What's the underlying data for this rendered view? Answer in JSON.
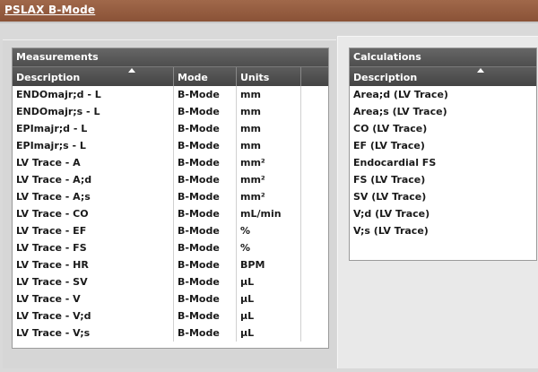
{
  "header": {
    "title": "PSLAX B-Mode"
  },
  "measurements": {
    "title": "Measurements",
    "columns": [
      "Description",
      "Mode",
      "Units"
    ],
    "rows": [
      [
        "ENDOmajr;d - L",
        "B-Mode",
        "mm"
      ],
      [
        "ENDOmajr;s - L",
        "B-Mode",
        "mm"
      ],
      [
        "EPImajr;d - L",
        "B-Mode",
        "mm"
      ],
      [
        "EPImajr;s - L",
        "B-Mode",
        "mm"
      ],
      [
        "LV Trace - A",
        "B-Mode",
        "mm²"
      ],
      [
        "LV Trace - A;d",
        "B-Mode",
        "mm²"
      ],
      [
        "LV Trace - A;s",
        "B-Mode",
        "mm²"
      ],
      [
        "LV Trace - CO",
        "B-Mode",
        "mL/min"
      ],
      [
        "LV Trace - EF",
        "B-Mode",
        "%"
      ],
      [
        "LV Trace - FS",
        "B-Mode",
        "%"
      ],
      [
        "LV Trace - HR",
        "B-Mode",
        "BPM"
      ],
      [
        "LV Trace - SV",
        "B-Mode",
        "µL"
      ],
      [
        "LV Trace - V",
        "B-Mode",
        "µL"
      ],
      [
        "LV Trace - V;d",
        "B-Mode",
        "µL"
      ],
      [
        "LV Trace - V;s",
        "B-Mode",
        "µL"
      ]
    ]
  },
  "calculations": {
    "title": "Calculations",
    "columns": [
      "Description"
    ],
    "rows": [
      "Area;d (LV Trace)",
      "Area;s (LV Trace)",
      "CO (LV Trace)",
      "EF (LV Trace)",
      "Endocardial FS",
      "FS (LV Trace)",
      "SV (LV Trace)",
      "V;d (LV Trace)",
      "V;s (LV Trace)"
    ]
  }
}
